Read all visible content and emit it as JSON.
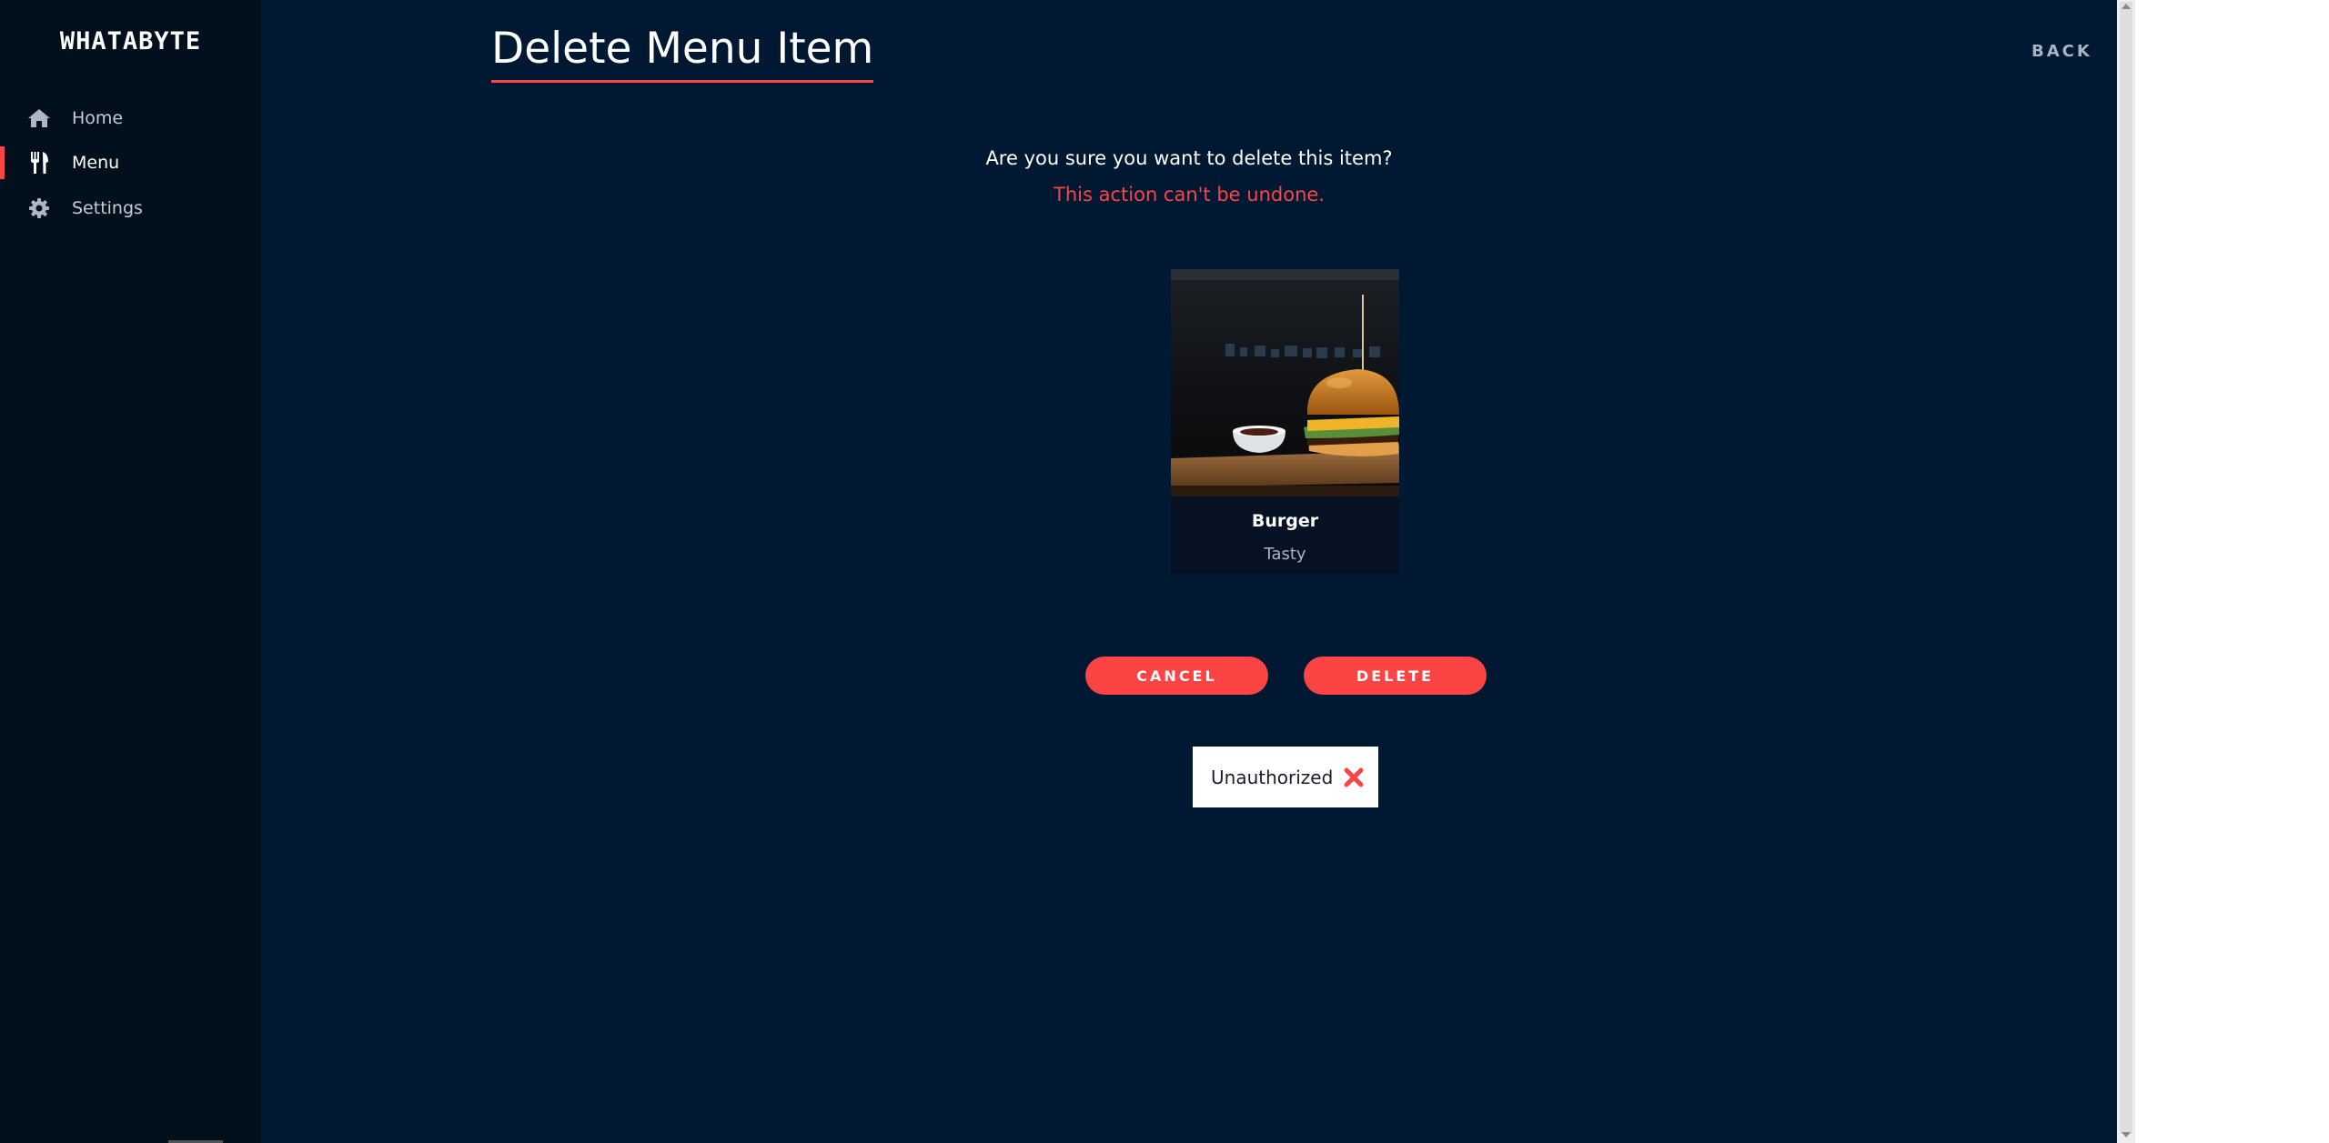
{
  "app": {
    "brand": "WHATABYTE"
  },
  "sidebar": {
    "items": [
      {
        "label": "Home",
        "icon": "home-icon",
        "active": false
      },
      {
        "label": "Menu",
        "icon": "utensils-icon",
        "active": true
      },
      {
        "label": "Settings",
        "icon": "gear-icon",
        "active": false
      }
    ]
  },
  "header": {
    "title": "Delete Menu Item",
    "back_label": "BACK"
  },
  "confirm": {
    "question": "Are you sure you want to delete this item?",
    "warning": "This action can't be undone."
  },
  "item": {
    "name": "Burger",
    "description": "Tasty",
    "image": "burger-photo"
  },
  "actions": {
    "cancel_label": "CANCEL",
    "delete_label": "DELETE"
  },
  "toast": {
    "message": "Unauthorized",
    "icon": "close-icon"
  },
  "colors": {
    "accent": "#fd4444",
    "sidebar_bg": "#020f1c",
    "main_bg": "#011833"
  }
}
